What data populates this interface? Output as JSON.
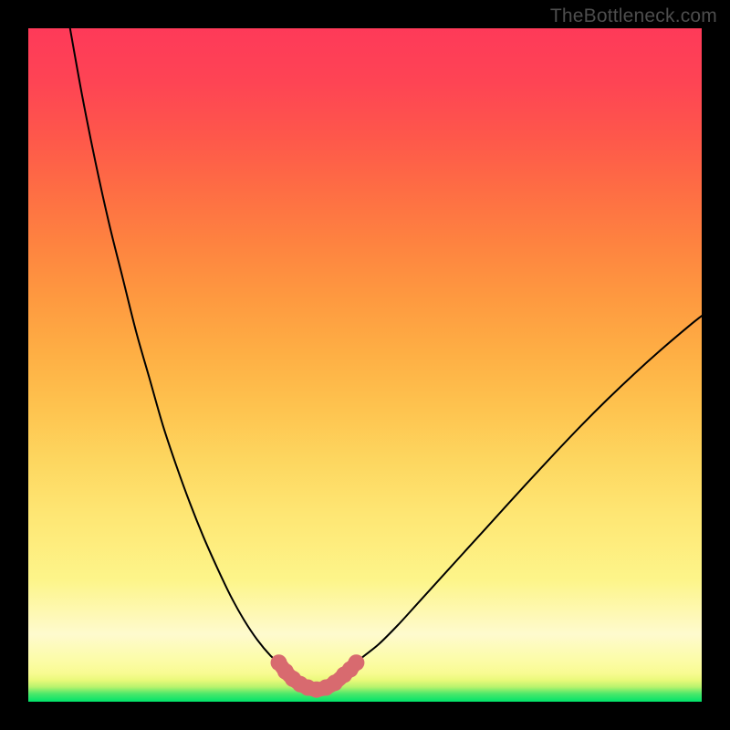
{
  "watermark": "TheBottleneck.com",
  "colors": {
    "frame": "#000000",
    "curve": "#000000",
    "marker": "#d86a6f",
    "gradient_top": "#fe3a59",
    "gradient_mid": "#fee673",
    "gradient_low": "#fcfca6",
    "gradient_bottom": "#00e36a"
  },
  "chart_data": {
    "type": "line",
    "title": "",
    "xlabel": "",
    "ylabel": "",
    "xlim": [
      0,
      1
    ],
    "ylim": [
      0,
      1
    ],
    "note": "V-shaped bottleneck curve over a green→red vertical gradient. Two decaying curve branches meet at a flat minimum near x≈0.42. The low portion near the minimum is highlighted with salmon markers.",
    "series": [
      {
        "name": "left-branch",
        "x": [
          0.062,
          0.08,
          0.1,
          0.12,
          0.14,
          0.16,
          0.18,
          0.2,
          0.22,
          0.24,
          0.26,
          0.28,
          0.3,
          0.32,
          0.34,
          0.36,
          0.372
        ],
        "y": [
          1.0,
          0.9,
          0.8,
          0.71,
          0.63,
          0.55,
          0.48,
          0.41,
          0.35,
          0.295,
          0.245,
          0.2,
          0.158,
          0.122,
          0.092,
          0.068,
          0.058
        ]
      },
      {
        "name": "floor",
        "x": [
          0.372,
          0.39,
          0.41,
          0.43,
          0.45,
          0.47,
          0.487
        ],
        "y": [
          0.058,
          0.033,
          0.022,
          0.018,
          0.022,
          0.033,
          0.058
        ]
      },
      {
        "name": "right-branch",
        "x": [
          0.487,
          0.52,
          0.55,
          0.58,
          0.62,
          0.66,
          0.7,
          0.74,
          0.78,
          0.82,
          0.86,
          0.9,
          0.94,
          0.98,
          1.0
        ],
        "y": [
          0.058,
          0.085,
          0.115,
          0.148,
          0.192,
          0.236,
          0.28,
          0.324,
          0.367,
          0.409,
          0.449,
          0.487,
          0.523,
          0.557,
          0.573
        ]
      },
      {
        "name": "highlight-markers",
        "x": [
          0.372,
          0.382,
          0.393,
          0.404,
          0.415,
          0.428,
          0.442,
          0.455,
          0.469,
          0.478,
          0.487
        ],
        "y": [
          0.058,
          0.045,
          0.034,
          0.026,
          0.021,
          0.018,
          0.021,
          0.028,
          0.04,
          0.048,
          0.058
        ]
      }
    ]
  }
}
